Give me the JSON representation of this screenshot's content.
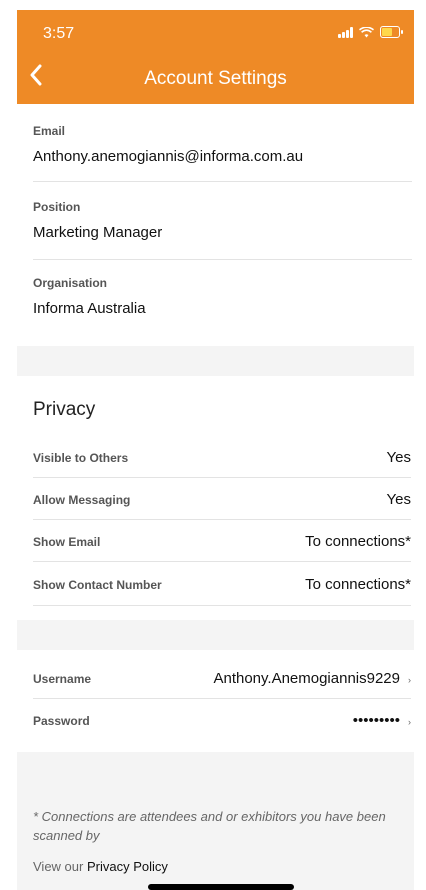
{
  "status": {
    "time": "3:57"
  },
  "header": {
    "title": "Account Settings"
  },
  "profile": [
    {
      "label": "Email",
      "value": "Anthony.anemogiannis@informa.com.au"
    },
    {
      "label": "Position",
      "value": "Marketing Manager"
    },
    {
      "label": "Organisation",
      "value": "Informa Australia"
    }
  ],
  "privacy": {
    "heading": "Privacy",
    "rows": [
      {
        "label": "Visible to Others",
        "value": "Yes"
      },
      {
        "label": "Allow Messaging",
        "value": "Yes"
      },
      {
        "label": "Show Email",
        "value": "To connections*"
      },
      {
        "label": "Show Contact Number",
        "value": "To connections*"
      }
    ]
  },
  "account": [
    {
      "label": "Username",
      "value": "Anthony.Anemogiannis9229"
    },
    {
      "label": "Password",
      "value": "•••••••••"
    }
  ],
  "footer": {
    "note": "* Connections are attendees and or exhibitors you have been scanned by",
    "policy_prefix": "View our ",
    "policy_link": "Privacy Policy"
  },
  "colors": {
    "accent": "#ee8a26",
    "band": "#f4f4f4"
  }
}
